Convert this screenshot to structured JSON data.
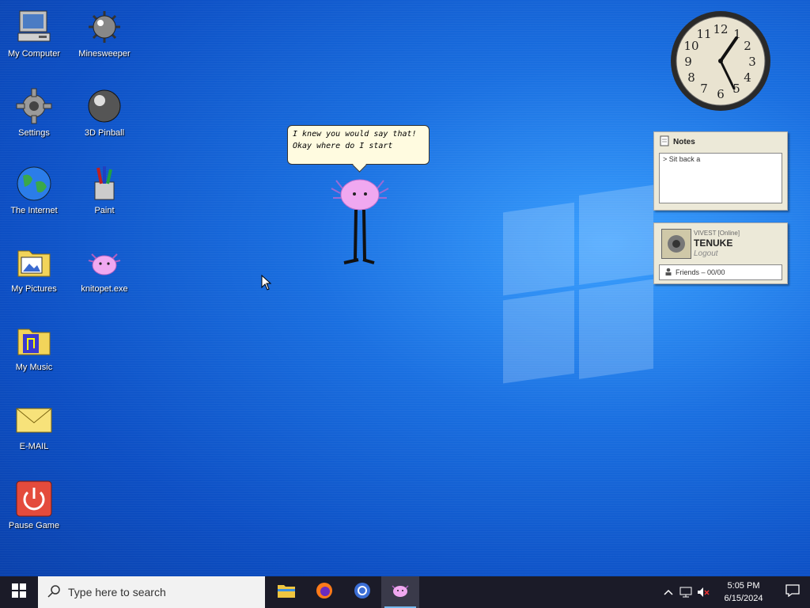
{
  "desktop": {
    "icons": [
      {
        "label": "My Computer",
        "icon": "computer-icon"
      },
      {
        "label": "Minesweeper",
        "icon": "mine-icon"
      },
      {
        "label": "Settings",
        "icon": "gear-icon"
      },
      {
        "label": "3D Pinball",
        "icon": "pinball-icon"
      },
      {
        "label": "The Internet",
        "icon": "globe-icon"
      },
      {
        "label": "Paint",
        "icon": "paint-icon"
      },
      {
        "label": "My Pictures",
        "icon": "pictures-folder-icon"
      },
      {
        "label": "knitopet.exe",
        "icon": "axolotl-icon"
      },
      {
        "label": "My Music",
        "icon": "music-folder-icon"
      },
      {
        "label": "E-MAIL",
        "icon": "envelope-icon"
      },
      {
        "label": "Pause Game",
        "icon": "power-icon"
      }
    ]
  },
  "pet": {
    "speech_line1": "I knew you would say that!",
    "speech_line2": "Okay where do I start"
  },
  "clock_widget": {
    "numbers": [
      "12",
      "1",
      "2",
      "3",
      "4",
      "5",
      "6",
      "7",
      "8",
      "9",
      "10",
      "11"
    ]
  },
  "notes_widget": {
    "title": "Notes",
    "content": "> Sit back a"
  },
  "profile_widget": {
    "status": "VIVEST [Online]",
    "username": "TENUKE",
    "logout": "Logout",
    "friends": "Friends – 00/00"
  },
  "taskbar": {
    "search_placeholder": "Type here to search",
    "time": "5:05 PM",
    "date": "6/15/2024"
  },
  "colors": {
    "taskbar_bg": "#1b1b28",
    "accent": "#76b9ed"
  }
}
